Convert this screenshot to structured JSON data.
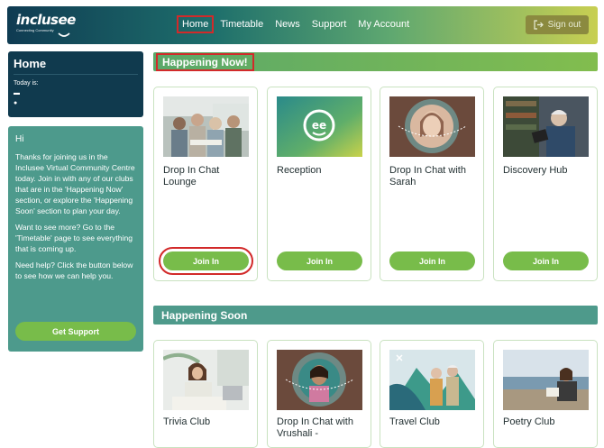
{
  "header": {
    "logo_text": "inclusee",
    "logo_tagline": "Connecting Community",
    "nav": [
      "Home",
      "Timetable",
      "News",
      "Support",
      "My Account"
    ],
    "active_nav": "Home",
    "signout_label": "Sign out"
  },
  "home_panel": {
    "title": "Home",
    "today_label": "Today is:"
  },
  "info_panel": {
    "greeting": "Hi",
    "paragraphs": [
      "Thanks for joining us in the Inclusee Virtual Community Centre today. Join in with any of our clubs that are in the 'Happening Now' section, or explore the 'Happening Soon' section to plan your day.",
      "Want to see more? Go to the 'Timetable' page to see everything that is coming up.",
      "Need help? Click the button below to see how we can help you."
    ],
    "support_label": "Get Support"
  },
  "happening_now": {
    "title": "Happening Now!",
    "cards": [
      {
        "title": "Drop In Chat Lounge",
        "button": "Join In"
      },
      {
        "title": "Reception",
        "button": "Join In"
      },
      {
        "title": "Drop In Chat with Sarah",
        "button": "Join In"
      },
      {
        "title": "Discovery Hub",
        "button": "Join In"
      }
    ]
  },
  "happening_soon": {
    "title": "Happening Soon",
    "cards": [
      {
        "title": "Trivia Club"
      },
      {
        "title": "Drop In Chat with Vrushali -"
      },
      {
        "title": "Travel Club"
      },
      {
        "title": "Poetry Club"
      }
    ]
  },
  "colors": {
    "accent_green": "#78bc4a",
    "dark_teal": "#103a4e",
    "panel_teal": "#4d9a8c",
    "highlight_red": "#d22a2a"
  }
}
